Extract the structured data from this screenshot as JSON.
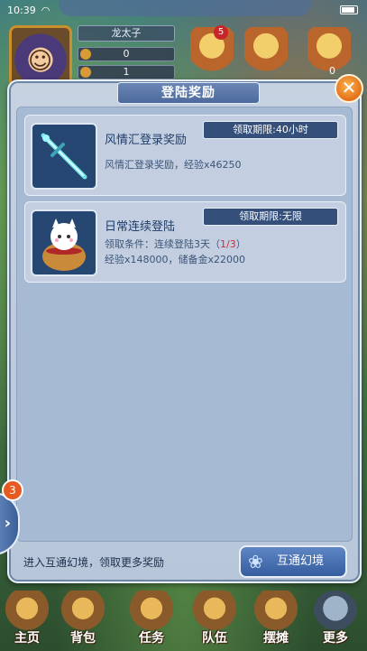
{
  "status_bar": {
    "time": "10:39",
    "wifi_icon": "wifi-icon",
    "battery_icon": "battery-icon"
  },
  "player": {
    "name": "龙太子",
    "stat_1": "0",
    "stat_2": "1"
  },
  "hud": {
    "badge_count": "5",
    "item_count": "0"
  },
  "dialog": {
    "title": "登陆奖励",
    "close_icon": "close-icon",
    "rewards": [
      {
        "title": "风情汇登录奖励",
        "deadline": "领取期限:40小时",
        "line1": "风情汇登录奖励，经验x46250",
        "icon": "crystal-sword-icon"
      },
      {
        "title": "日常连续登陆",
        "deadline": "领取期限:无限",
        "line1_prefix": "领取条件：连续登陆3天（",
        "line1_progress": "1/3",
        "line1_suffix": "）",
        "line2": "经验x148000，储备金x22000",
        "icon": "cat-pouch-icon"
      }
    ],
    "footer_text": "进入互通幻境，领取更多奖励",
    "portal_button": "互通幻境",
    "portal_icon": "dream-icon"
  },
  "side_tab": {
    "badge": "3",
    "icon": "chevron-right-icon"
  },
  "bottom_menu": [
    {
      "label": "主页",
      "icon": "home-icon"
    },
    {
      "label": "背包",
      "icon": "backpack-icon"
    },
    {
      "label": "任务",
      "icon": "scroll-icon"
    },
    {
      "label": "队伍",
      "icon": "team-icon"
    },
    {
      "label": "摆摊",
      "icon": "stall-icon"
    },
    {
      "label": "更多",
      "icon": "more-icon"
    }
  ]
}
